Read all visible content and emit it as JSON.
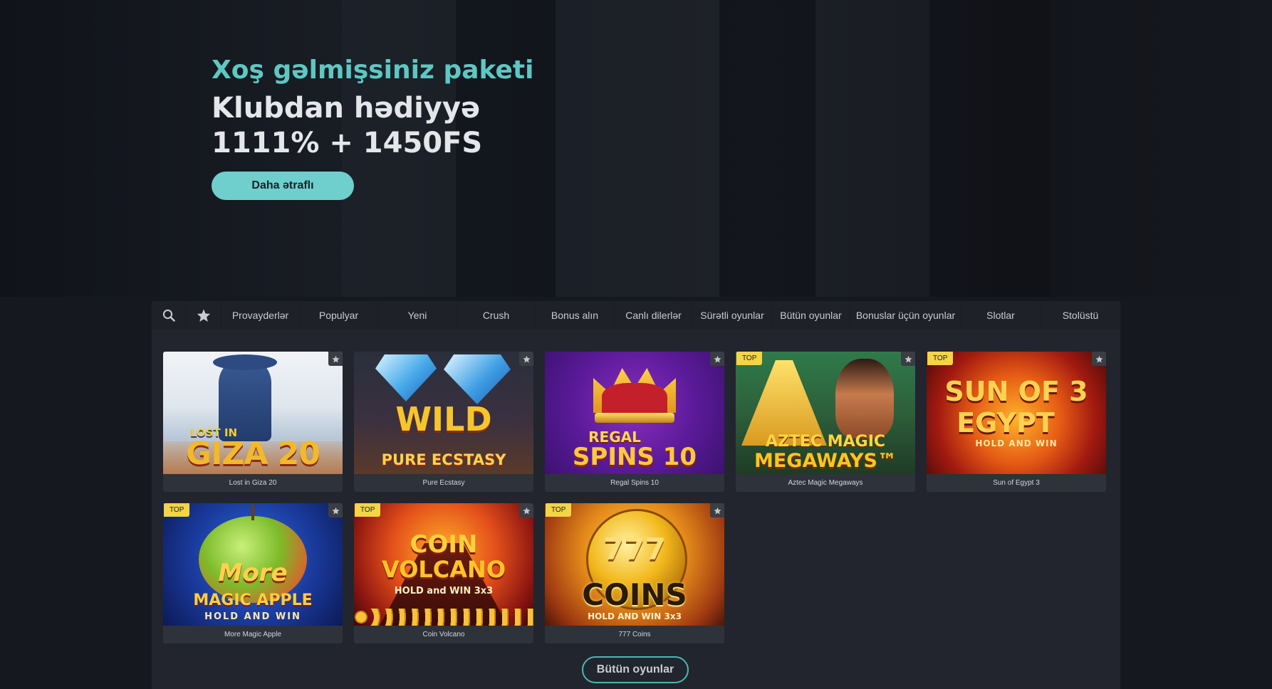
{
  "hero": {
    "subtitle": "Xoş gəlmişsiniz paketi",
    "title_line1": "Klubdan hədiyyə",
    "title_line2": "1111% + 1450FS",
    "button": "Daha ətraflı"
  },
  "nav": {
    "search_icon": "search-icon",
    "favorites_icon": "star-icon",
    "tabs": [
      "Provayderlər",
      "Populyar",
      "Yeni",
      "Crush",
      "Bonus alın",
      "Canlı dilerlər",
      "Sürətli oyunlar",
      "Bütün oyunlar",
      "Bonuslar üçün oyunlar",
      "Slotlar",
      "Stolüstü"
    ]
  },
  "games": [
    {
      "name": "Lost in Giza 20",
      "top": false,
      "art": [
        "LOST IN",
        "GIZA 20"
      ]
    },
    {
      "name": "Pure Ecstasy",
      "top": false,
      "art": [
        "WILD",
        "PURE ECSTASY"
      ]
    },
    {
      "name": "Regal Spins 10",
      "top": false,
      "art": [
        "REGAL",
        "SPINS 10"
      ]
    },
    {
      "name": "Aztec Magic Megaways",
      "top": true,
      "art": [
        "AZTEC MAGIC",
        "MEGAWAYS™"
      ]
    },
    {
      "name": "Sun of Egypt 3",
      "top": true,
      "art": [
        "SUN OF 3",
        "EGYPT",
        "HOLD AND WIN"
      ]
    },
    {
      "name": "More Magic Apple",
      "top": true,
      "art": [
        "More",
        "MAGIC APPLE",
        "HOLD AND WIN"
      ]
    },
    {
      "name": "Coin Volcano",
      "top": true,
      "art": [
        "COIN",
        "VOLCANO",
        "HOLD and WIN 3x3"
      ]
    },
    {
      "name": "777 Coins",
      "top": true,
      "art": [
        "777",
        "COINS",
        "HOLD AND WIN 3x3"
      ]
    }
  ],
  "badge_label": "TOP",
  "all_games_button": "Bütün oyunlar",
  "colors": {
    "accent": "#5ec7c3",
    "button": "#6ecfcc",
    "badge": "#f3d545",
    "background": "#15181e",
    "panel": "#22252d"
  }
}
